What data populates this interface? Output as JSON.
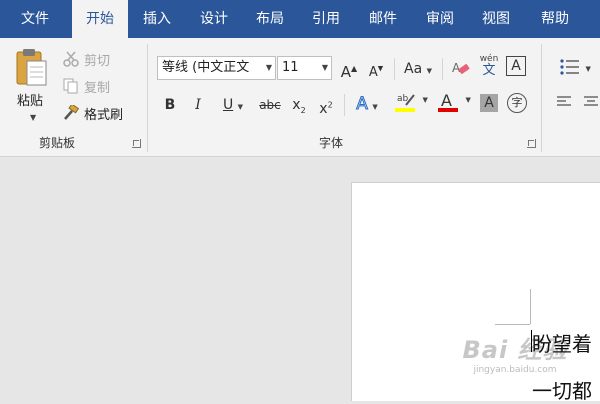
{
  "tabs": [
    {
      "label": "文件",
      "active": false
    },
    {
      "label": "开始",
      "active": true
    },
    {
      "label": "插入",
      "active": false
    },
    {
      "label": "设计",
      "active": false
    },
    {
      "label": "布局",
      "active": false
    },
    {
      "label": "引用",
      "active": false
    },
    {
      "label": "邮件",
      "active": false
    },
    {
      "label": "审阅",
      "active": false
    },
    {
      "label": "视图",
      "active": false
    },
    {
      "label": "帮助",
      "active": false
    }
  ],
  "clipboard": {
    "paste_label": "粘贴",
    "cut_label": "剪切",
    "copy_label": "复制",
    "format_painter_label": "格式刷",
    "group_label": "剪贴板"
  },
  "font": {
    "font_name": "等线 (中文正文",
    "font_size": "11",
    "group_label": "字体",
    "phonetic_label": "wén",
    "colors": {
      "highlight": "#ffff00",
      "font_color": "#e00000",
      "accent": "#2b579a"
    }
  },
  "document": {
    "line1": "盼望着",
    "line2": "一切都"
  },
  "watermark": {
    "main": "Bai 经验",
    "sub": "jingyan.baidu.com"
  }
}
